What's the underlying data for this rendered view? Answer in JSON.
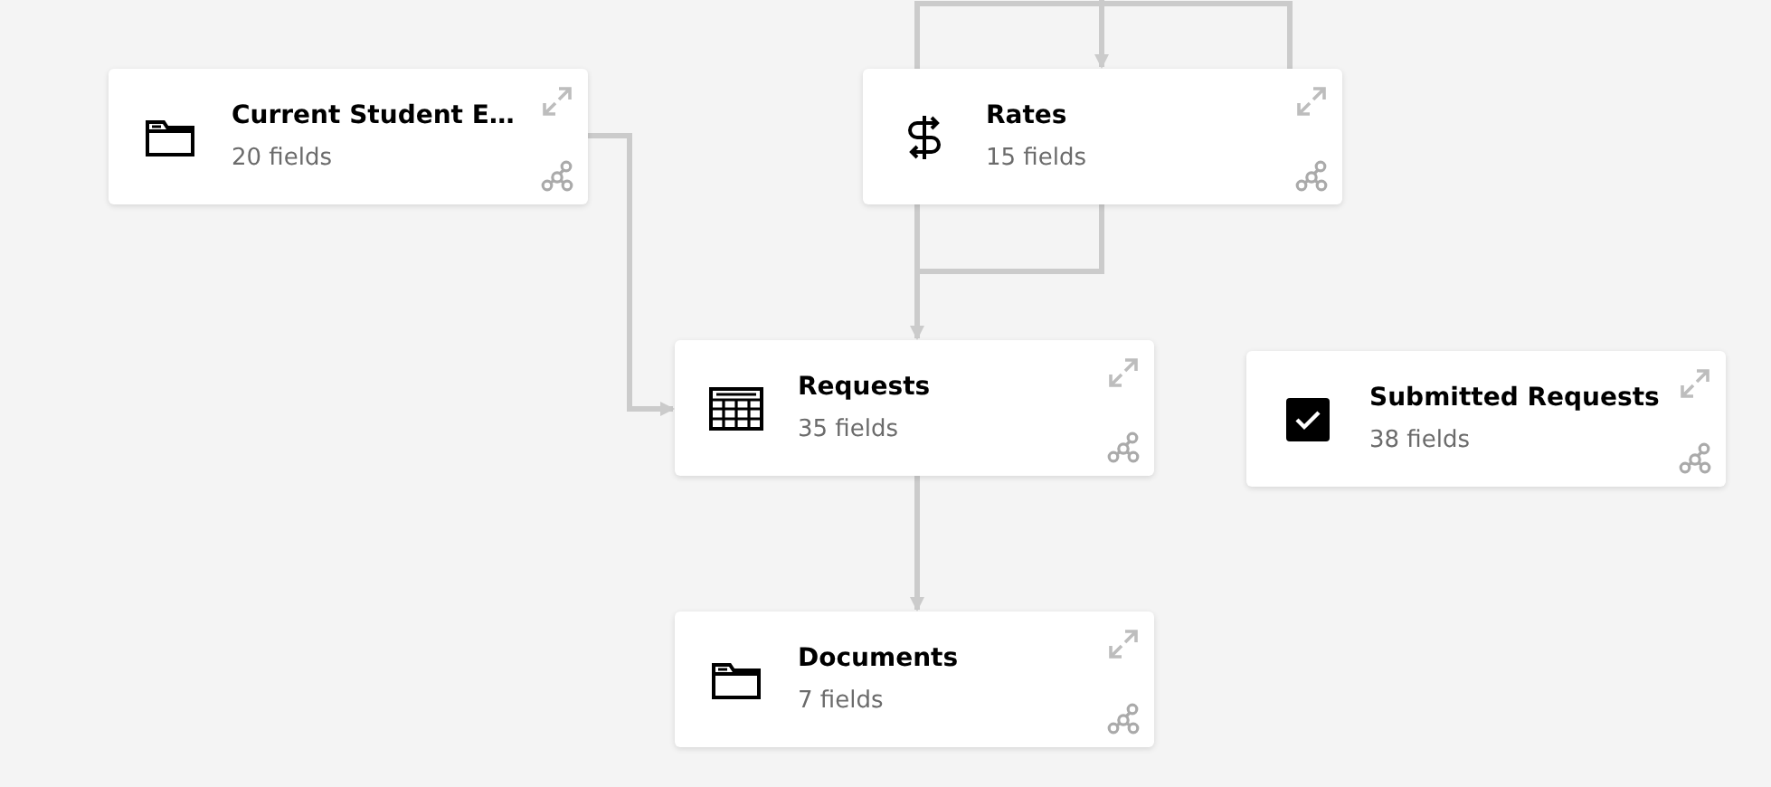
{
  "nodes": [
    {
      "kind": "folder",
      "title": "Current Student E…",
      "subtitle": "20 fields"
    },
    {
      "kind": "currency",
      "title": "Rates",
      "subtitle": "15 fields"
    },
    {
      "kind": "table",
      "title": "Requests",
      "subtitle": "35 fields"
    },
    {
      "kind": "checkbox",
      "title": "Submitted Requests",
      "subtitle": "38 fields"
    },
    {
      "kind": "folder",
      "title": "Documents",
      "subtitle": "7 fields"
    }
  ]
}
